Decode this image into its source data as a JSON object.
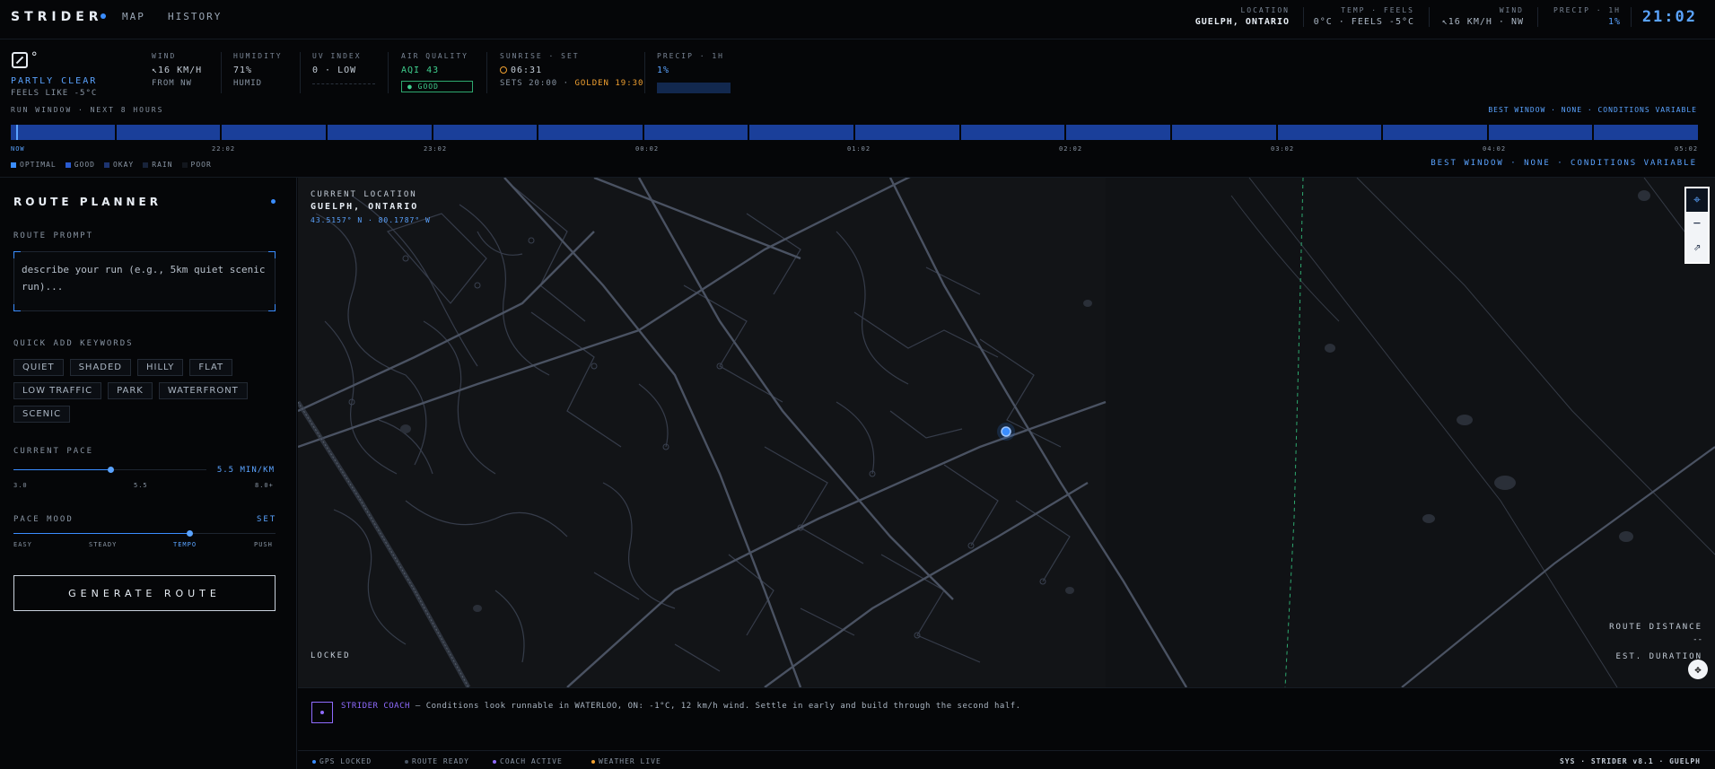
{
  "app": {
    "brand": "STRIDER",
    "nav": [
      {
        "label": "MAP"
      },
      {
        "label": "HISTORY"
      }
    ],
    "clock": "21:02"
  },
  "header_stats": {
    "location": {
      "label": "LOCATION",
      "value": "GUELPH, ONTARIO"
    },
    "temp": {
      "label": "TEMP · FEELS",
      "value": "0°C · FEELS -5°C"
    },
    "wind": {
      "label": "WIND",
      "value": "↖16 KM/H · NW"
    },
    "precip": {
      "label": "PRECIP · 1H",
      "value": "1%"
    }
  },
  "weather": {
    "icon": "partly-clear-icon",
    "degree_symbol": "°",
    "condition": "PARTLY CLEAR",
    "feels": "FEELS LIKE -5°C",
    "wind": {
      "label": "WIND",
      "value": "↖16 KM/H",
      "sub": "FROM NW"
    },
    "humidity": {
      "label": "HUMIDITY",
      "value": "71%",
      "sub": "HUMID"
    },
    "uv": {
      "label": "UV INDEX",
      "value": "0 · LOW"
    },
    "air": {
      "label": "AIR QUALITY",
      "value": "AQI 43",
      "badge": "● GOOD"
    },
    "sun": {
      "label": "SUNRISE · SET",
      "rise": "06:31",
      "sets": "SETS 20:00 ·",
      "golden": "GOLDEN 19:30"
    },
    "precip": {
      "label": "PRECIP · 1H",
      "value": "1%",
      "fraction": 0.01
    }
  },
  "run_window": {
    "title": "RUN WINDOW · NEXT 8 HOURS",
    "best_top": "BEST WINDOW · NONE · CONDITIONS VARIABLE",
    "best_bottom": "BEST WINDOW · NONE · CONDITIONS VARIABLE",
    "segments": 16,
    "ticks": [
      "NOW",
      "22:02",
      "23:02",
      "00:02",
      "01:02",
      "02:02",
      "03:02",
      "04:02",
      "05:02"
    ],
    "legend": [
      {
        "label": "OPTIMAL",
        "color": "#3a8dff"
      },
      {
        "label": "GOOD",
        "color": "#2a5bd0"
      },
      {
        "label": "OKAY",
        "color": "#1d3470"
      },
      {
        "label": "RAIN",
        "color": "#18233a"
      },
      {
        "label": "POOR",
        "color": "#12161d"
      }
    ]
  },
  "sidebar": {
    "title": "ROUTE PLANNER",
    "prompt_label": "ROUTE PROMPT",
    "prompt_placeholder": "describe your run (e.g., 5km quiet scenic run)...",
    "keywords_label": "QUICK ADD KEYWORDS",
    "keywords": [
      "QUIET",
      "SHADED",
      "HILLY",
      "FLAT",
      "LOW TRAFFIC",
      "PARK",
      "WATERFRONT",
      "SCENIC"
    ],
    "pace": {
      "label": "CURRENT PACE",
      "value": "5.5 MIN/KM",
      "min": "3.0",
      "mid": "5.5",
      "max": "8.0+",
      "fraction": 0.5
    },
    "mood": {
      "label": "PACE MOOD",
      "set": "SET",
      "options": [
        "EASY",
        "STEADY",
        "TEMPO",
        "PUSH"
      ],
      "selected": "TEMPO",
      "fraction": 0.67
    },
    "generate": "GENERATE ROUTE"
  },
  "map": {
    "current_label": "CURRENT LOCATION",
    "current_name": "GUELPH, ONTARIO",
    "coords": "43.5157° N · 80.1787° W",
    "locked": "LOCKED",
    "route_distance_label": "ROUTE DISTANCE",
    "route_distance_value": "--",
    "est_duration_label": "EST. DURATION",
    "controls": [
      {
        "name": "locate-icon",
        "glyph": "⌖"
      },
      {
        "name": "zoom-minus-icon",
        "glyph": "−"
      },
      {
        "name": "north-arrow-icon",
        "glyph": "⇗"
      }
    ],
    "compass_glyph": "✥"
  },
  "coach": {
    "name": "STRIDER COACH",
    "message": " — Conditions look runnable in WATERLOO, ON: -1°C, 12 km/h wind. Settle in early and build through the second half."
  },
  "status": {
    "items": [
      {
        "label": "GPS LOCKED",
        "color": "#3a8dff"
      },
      {
        "label": "ROUTE READY",
        "color": "#4a5564"
      },
      {
        "label": "COACH ACTIVE",
        "color": "#8f6bff"
      },
      {
        "label": "WEATHER LIVE",
        "color": "#f0a030"
      }
    ],
    "sys": "SYS · STRIDER v8.1 · GUELPH"
  }
}
